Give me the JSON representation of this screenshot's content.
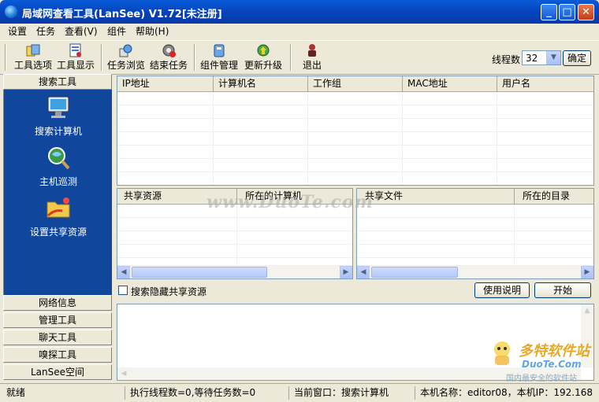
{
  "window": {
    "title": "局域网查看工具(LanSee) V1.72[未注册]",
    "controls": [
      "minimize",
      "maximize",
      "close"
    ]
  },
  "menubar": [
    {
      "label": "设置"
    },
    {
      "label": "任务"
    },
    {
      "label": "查看(V)"
    },
    {
      "label": "组件"
    },
    {
      "label": "帮助(H)"
    }
  ],
  "toolbar": {
    "items": [
      {
        "label": "工具选项",
        "icon": "tool-options-icon"
      },
      {
        "label": "工具显示",
        "icon": "tool-display-icon"
      },
      {
        "label": "任务浏览",
        "icon": "task-browse-icon"
      },
      {
        "label": "结束任务",
        "icon": "end-task-icon"
      },
      {
        "label": "组件管理",
        "icon": "component-manage-icon"
      },
      {
        "label": "更新升级",
        "icon": "update-icon"
      },
      {
        "label": "退出",
        "icon": "exit-icon"
      }
    ],
    "threads_label": "线程数",
    "threads_value": "32",
    "confirm_label": "确定"
  },
  "left_panel": {
    "search_header": "搜索工具",
    "tools": [
      {
        "label": "搜索计算机",
        "icon": "monitor-icon"
      },
      {
        "label": "主机巡测",
        "icon": "magnifier-globe-icon"
      },
      {
        "label": "设置共享资源",
        "icon": "shared-folder-icon"
      }
    ],
    "sections": [
      "网络信息",
      "管理工具",
      "聊天工具",
      "嗅探工具",
      "LanSee空间"
    ]
  },
  "computers_table": {
    "columns": [
      "IP地址",
      "计算机名",
      "工作组",
      "MAC地址",
      "用户名"
    ],
    "rows": []
  },
  "shares_table": {
    "columns": [
      "共享资源",
      "所在的计算机"
    ],
    "rows": []
  },
  "files_table": {
    "columns": [
      "共享文件",
      "所在的目录"
    ],
    "rows": []
  },
  "options": {
    "search_hidden_label": "搜索隐藏共享资源",
    "search_hidden_checked": false,
    "help_button": "使用说明",
    "start_button": "开始"
  },
  "statusbar": {
    "status": "就绪",
    "tasks": "执行线程数=0,等待任务数=0",
    "current_window": "当前窗口：搜索计算机",
    "host": "本机名称：editor08，本机IP：192.168"
  },
  "watermarks": {
    "center": "www.DuoTe.com",
    "corner_logo": "多特软件站",
    "corner_url": "DuoTe.Com",
    "corner_slogan": "国内最安全的软件站"
  },
  "colors": {
    "title_bar": "#0441b8",
    "left_panel_bg": "#10479d",
    "window_bg": "#ece9d8"
  }
}
